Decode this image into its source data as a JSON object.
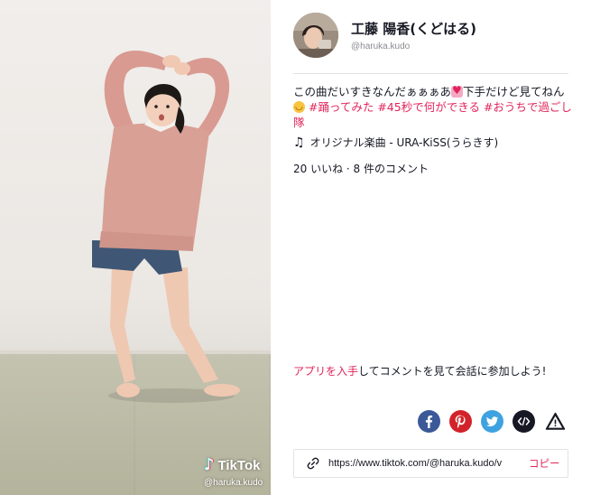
{
  "video": {
    "watermark_logo": "TikTok",
    "watermark_handle": "@haruka.kudo"
  },
  "author": {
    "name": "工藤 陽香(くどはる)",
    "handle": "@haruka.kudo"
  },
  "caption": {
    "text_1": "この曲だいすきなんだぁぁぁあ",
    "text_2": "下手だけど見てねん",
    "hashtags": [
      "#踊ってみた",
      "#45秒で何ができる",
      "#おうちで過ごし隊"
    ]
  },
  "music": {
    "icon": "music-note-icon",
    "label": "オリジナル楽曲 - URA-KiSS(うらきす)"
  },
  "stats": {
    "text": "20 いいね · 8 件のコメント"
  },
  "cta": {
    "link_text": "アプリを入手",
    "rest_text": "してコメントを見て会話に参加しよう!"
  },
  "share": {
    "items": [
      {
        "name": "facebook",
        "icon": "facebook-icon",
        "color": "#3b5998"
      },
      {
        "name": "pinterest",
        "icon": "pinterest-icon",
        "color": "#d2232a"
      },
      {
        "name": "twitter",
        "icon": "twitter-icon",
        "color": "#3ea2e0"
      },
      {
        "name": "embed",
        "icon": "embed-code-icon",
        "color": "#161823"
      },
      {
        "name": "report",
        "icon": "warning-icon",
        "color": "#161823"
      }
    ]
  },
  "url_box": {
    "url": "https://www.tiktok.com/@haruka.kudo/v",
    "copy_label": "コピー",
    "icon": "link-icon"
  },
  "colors": {
    "accent": "#e2245a",
    "text": "#161823",
    "muted": "#8a8b91"
  }
}
